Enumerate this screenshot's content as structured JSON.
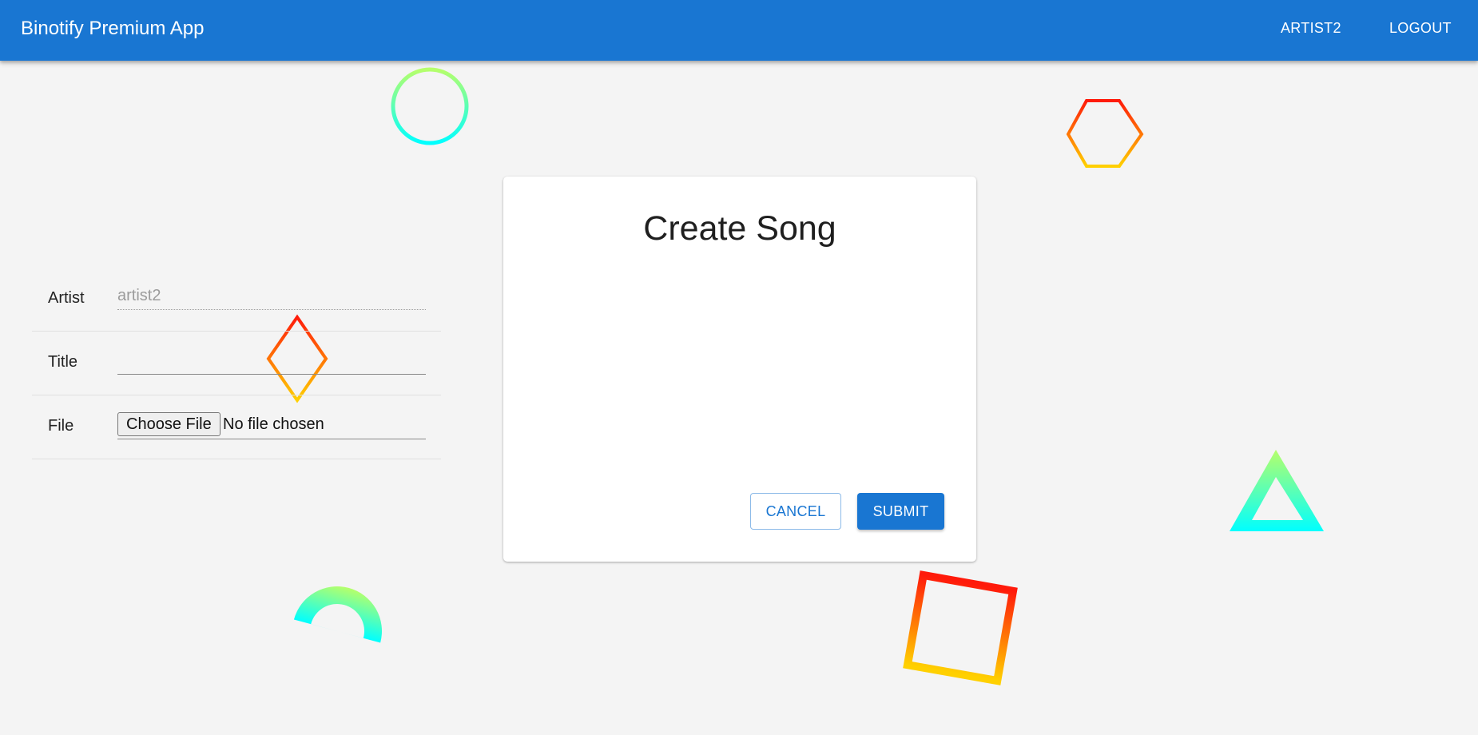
{
  "app": {
    "title": "Binotify Premium App"
  },
  "nav": {
    "user_label": "ARTIST2",
    "logout_label": "LOGOUT"
  },
  "form": {
    "title": "Create Song",
    "fields": {
      "artist": {
        "label": "Artist",
        "value": "artist2"
      },
      "title": {
        "label": "Title",
        "value": ""
      },
      "file": {
        "label": "File",
        "button_label": "Choose File",
        "status": "No file chosen"
      }
    },
    "actions": {
      "cancel_label": "CANCEL",
      "submit_label": "SUBMIT"
    }
  },
  "colors": {
    "appbar": "#1976d2",
    "background": "#f4f4f4",
    "card": "#ffffff",
    "primary": "#1976d2",
    "gradient_warm_start": "#ff1a0a",
    "gradient_warm_end": "#ffd000",
    "gradient_cool_start": "#b6ff6a",
    "gradient_cool_end": "#00ffff"
  },
  "decorations": [
    {
      "shape": "circle-outline",
      "gradient": "cool"
    },
    {
      "shape": "hexagon-outline",
      "gradient": "warm"
    },
    {
      "shape": "diamond-outline",
      "gradient": "warm"
    },
    {
      "shape": "triangle-outline",
      "gradient": "cool"
    },
    {
      "shape": "half-circle",
      "gradient": "cool"
    },
    {
      "shape": "square-outline",
      "gradient": "warm"
    }
  ]
}
